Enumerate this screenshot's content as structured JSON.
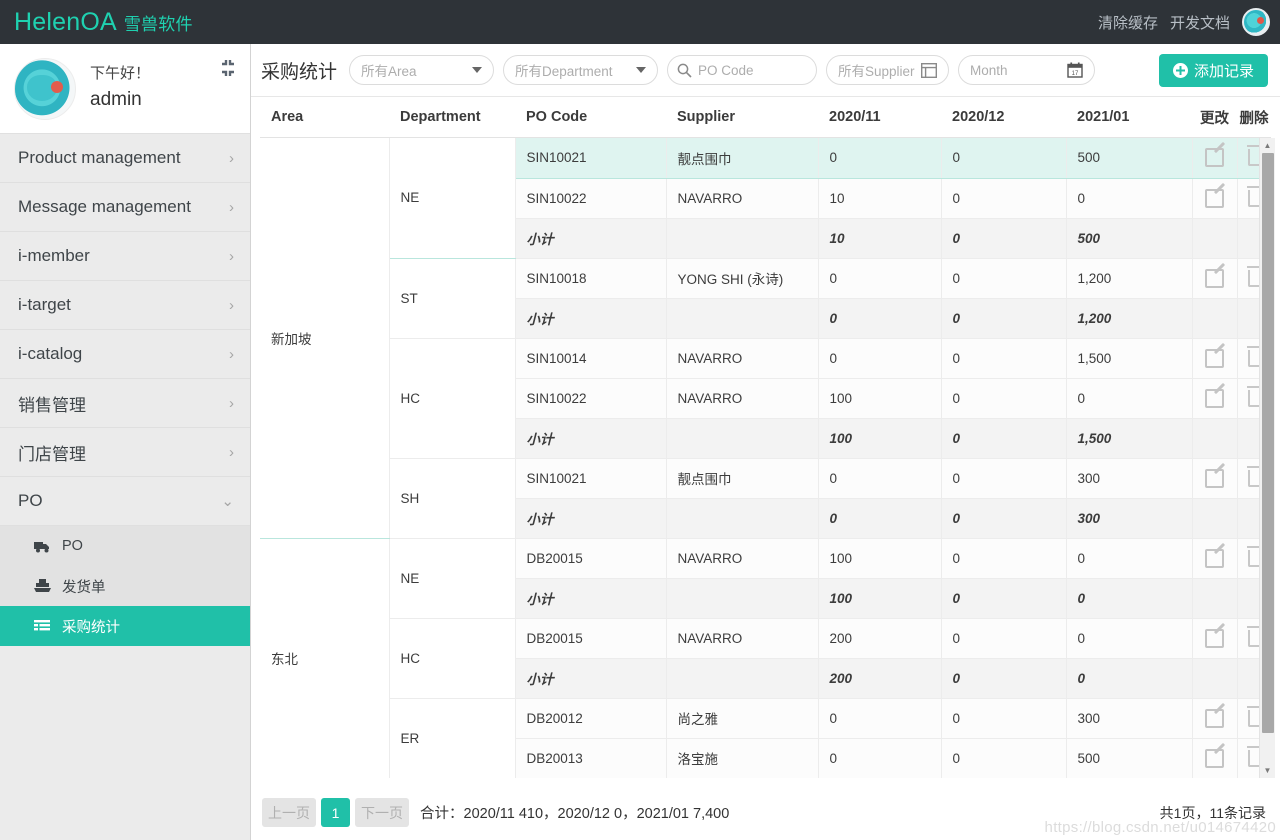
{
  "topbar": {
    "brand": "HelenOA",
    "brand_sub": "雪兽软件",
    "links": [
      "清除缓存",
      "开发文档"
    ],
    "avatar_icon": "user-avatar-icon"
  },
  "sidebar": {
    "greeting": "下午好！",
    "username": "admin",
    "collapse_icon": "collapse-icon",
    "items": [
      {
        "label": "Product management",
        "chevron": "›"
      },
      {
        "label": "Message management",
        "chevron": "›"
      },
      {
        "label": "i-member",
        "chevron": "›"
      },
      {
        "label": "i-target",
        "chevron": "›"
      },
      {
        "label": "i-catalog",
        "chevron": "›"
      },
      {
        "label": "销售管理",
        "chevron": "›"
      },
      {
        "label": "门店管理",
        "chevron": "›"
      },
      {
        "label": "PO",
        "chevron": "⌄"
      }
    ],
    "submenu": [
      {
        "label": "PO",
        "icon": "truck-icon",
        "active": false
      },
      {
        "label": "发货单",
        "icon": "ship-icon",
        "active": false
      },
      {
        "label": "采购统计",
        "icon": "list-icon",
        "active": true
      }
    ]
  },
  "toolbar": {
    "title": "采购统计",
    "filter_area": "所有Area",
    "filter_department": "所有Department",
    "search_placeholder": "PO Code",
    "search_icon": "search-icon",
    "filter_supplier": "所有Supplier",
    "supplier_icon": "window-icon",
    "filter_month": "Month",
    "month_icon": "calendar-icon",
    "add_button": "添加记录",
    "add_icon": "plus-circle-icon"
  },
  "table": {
    "headers": [
      "Area",
      "Department",
      "PO Code",
      "Supplier",
      "2020/11",
      "2020/12",
      "2021/01",
      "更改",
      "删除"
    ],
    "edit_icon": "edit-pencil-icon",
    "delete_icon": "trash-icon",
    "subtotal_label": "小计",
    "groups": [
      {
        "area": "新加坡",
        "departments": [
          {
            "dept": "NE",
            "rows": [
              {
                "code": "SIN10021",
                "supplier": "靓点围巾",
                "m1": "0",
                "m2": "0",
                "m3": "500",
                "highlight": true
              },
              {
                "code": "SIN10022",
                "supplier": "NAVARRO",
                "m1": "10",
                "m2": "0",
                "m3": "0",
                "highlight": false
              }
            ],
            "subtotal": {
              "m1": "10",
              "m2": "0",
              "m3": "500"
            }
          },
          {
            "dept": "ST",
            "rows": [
              {
                "code": "SIN10018",
                "supplier": "YONG SHI (永诗)",
                "m1": "0",
                "m2": "0",
                "m3": "1,200",
                "highlight": false
              }
            ],
            "subtotal": {
              "m1": "0",
              "m2": "0",
              "m3": "1,200"
            }
          },
          {
            "dept": "HC",
            "rows": [
              {
                "code": "SIN10014",
                "supplier": "NAVARRO",
                "m1": "0",
                "m2": "0",
                "m3": "1,500",
                "highlight": false
              },
              {
                "code": "SIN10022",
                "supplier": "NAVARRO",
                "m1": "100",
                "m2": "0",
                "m3": "0",
                "highlight": false
              }
            ],
            "subtotal": {
              "m1": "100",
              "m2": "0",
              "m3": "1,500"
            }
          },
          {
            "dept": "SH",
            "rows": [
              {
                "code": "SIN10021",
                "supplier": "靓点围巾",
                "m1": "0",
                "m2": "0",
                "m3": "300",
                "highlight": false
              }
            ],
            "subtotal": {
              "m1": "0",
              "m2": "0",
              "m3": "300"
            }
          }
        ]
      },
      {
        "area": "东北",
        "departments": [
          {
            "dept": "NE",
            "rows": [
              {
                "code": "DB20015",
                "supplier": "NAVARRO",
                "m1": "100",
                "m2": "0",
                "m3": "0",
                "highlight": false
              }
            ],
            "subtotal": {
              "m1": "100",
              "m2": "0",
              "m3": "0"
            }
          },
          {
            "dept": "HC",
            "rows": [
              {
                "code": "DB20015",
                "supplier": "NAVARRO",
                "m1": "200",
                "m2": "0",
                "m3": "0",
                "highlight": false
              }
            ],
            "subtotal": {
              "m1": "200",
              "m2": "0",
              "m3": "0"
            }
          },
          {
            "dept": "ER",
            "rows": [
              {
                "code": "DB20012",
                "supplier": "尚之雅",
                "m1": "0",
                "m2": "0",
                "m3": "300",
                "highlight": false
              },
              {
                "code": "DB20013",
                "supplier": "洛宝施",
                "m1": "0",
                "m2": "0",
                "m3": "500",
                "highlight": false
              }
            ],
            "subtotal": null
          }
        ]
      }
    ]
  },
  "footer": {
    "prev": "上一页",
    "page": "1",
    "next": "下一页",
    "total": "合计：2020/11 410，2020/12 0，2021/01 7,400",
    "records": "共1页，11条记录",
    "watermark": "https://blog.csdn.net/u014674420"
  }
}
